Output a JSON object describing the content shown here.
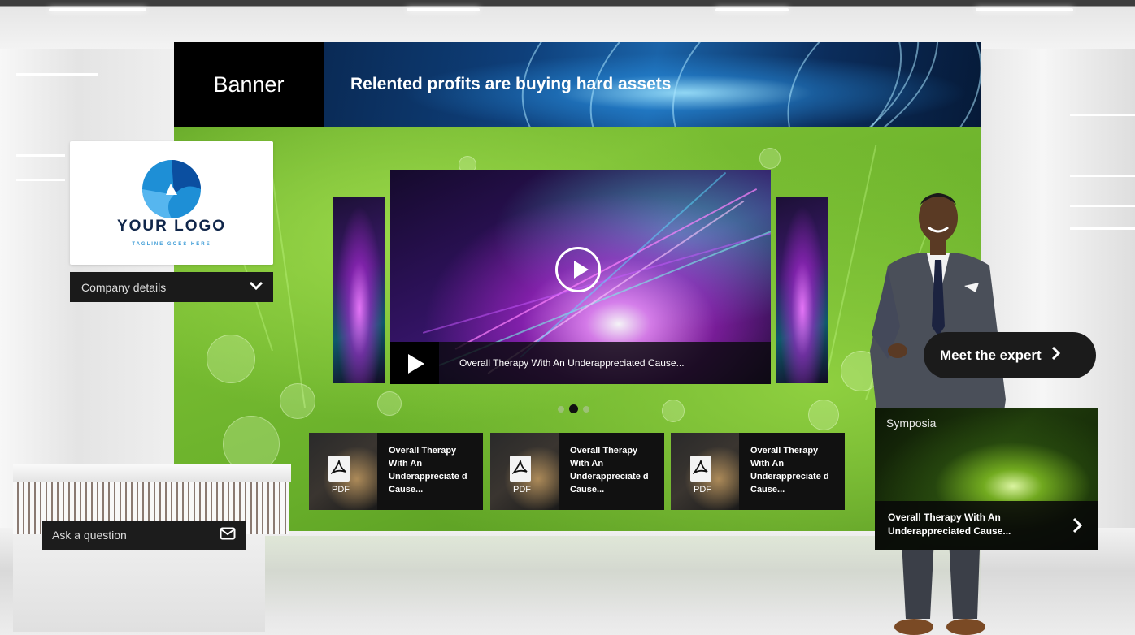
{
  "banner": {
    "label": "Banner",
    "headline": "Relented profits are buying hard assets"
  },
  "logo": {
    "name": "YOUR LOGO",
    "tagline": "TAGLINE GOES HERE",
    "brand_color": "#1e8fd6"
  },
  "company_details": {
    "label": "Company details",
    "icon": "chevron-down-icon"
  },
  "ask_question": {
    "label": "Ask a question",
    "icon": "envelope-icon"
  },
  "video_carousel": {
    "main_caption": "Overall Therapy With An Underappreciated Cause...",
    "slides_count": 3,
    "active_slide": 2
  },
  "documents": [
    {
      "type": "PDF",
      "title": "Overall Therapy With An Underappreciate d Cause..."
    },
    {
      "type": "PDF",
      "title": "Overall Therapy With An Underappreciate d Cause..."
    },
    {
      "type": "PDF",
      "title": "Overall Therapy With An Underappreciate d Cause..."
    }
  ],
  "expert": {
    "button_label": "Meet the expert",
    "icon": "chevron-right-icon"
  },
  "symposia": {
    "label": "Symposia",
    "title": "Overall Therapy With An Underappreciated Cause...",
    "icon": "chevron-right-icon"
  }
}
